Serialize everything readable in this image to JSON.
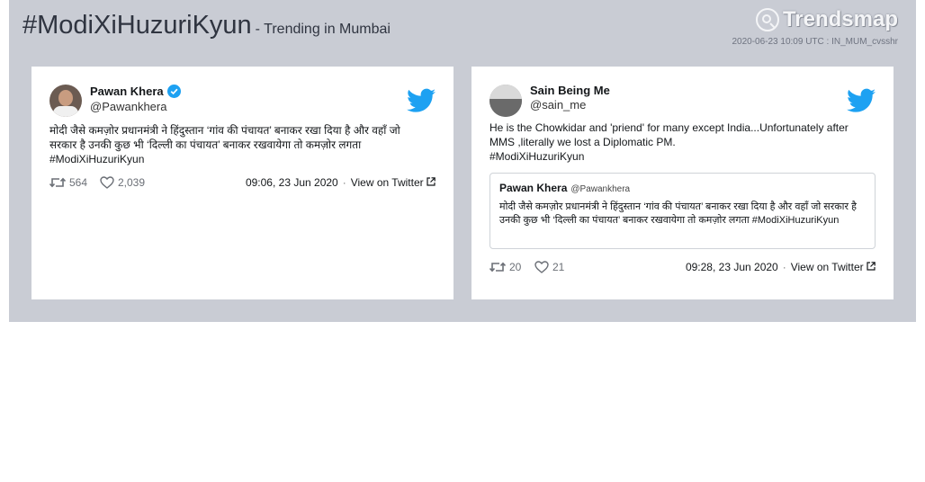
{
  "header": {
    "hashtag": "#ModiXiHuzuriKyun",
    "subtitle": "- Trending in Mumbai",
    "logo_text": "Trendsmap",
    "timestamp": "2020-06-23 10:09 UTC : IN_MUM_cvsshr"
  },
  "tweets": [
    {
      "name": "Pawan Khera",
      "verified": true,
      "handle": "@Pawankhera",
      "text": "मोदी जैसे कमज़ोर प्रधानमंत्री ने हिंदुस्तान ‘गांव की पंचायत’ बनाकर रखा दिया है और वहाँ जो सरकार है उनकी कुछ भी ‘दिल्ली का पंचायत’ बनाकर रखवायेगा तो कमज़ोर लगता",
      "hashtag": "#ModiXiHuzuriKyun",
      "retweets": "564",
      "likes": "2,039",
      "time": "09:06, 23 Jun 2020",
      "view_link": "View on Twitter"
    },
    {
      "name": "Sain Being Me",
      "verified": false,
      "handle": "@sain_me",
      "text": "He is the Chowkidar and 'priend' for many except India...Unfortunately after MMS ,literally we lost a Diplomatic PM.",
      "hashtag": "#ModiXiHuzuriKyun",
      "quote": {
        "name": "Pawan Khera",
        "handle": "@Pawankhera",
        "text": "मोदी जैसे कमज़ोर प्रधानमंत्री ने हिंदुस्तान ‘गांव की पंचायत’ बनाकर रखा दिया है और वहाँ जो सरकार है उनकी कुछ भी ‘दिल्ली का पंचायत’ बनाकर रखवायेगा तो कमज़ोर लगता",
        "hashtag": "#ModiXiHuzuriKyun"
      },
      "retweets": "20",
      "likes": "21",
      "time": "09:28, 23 Jun 2020",
      "view_link": "View on Twitter"
    }
  ],
  "colors": {
    "panel_bg": "#c9ccd4",
    "twitter_blue": "#1da1f2",
    "text_dark": "#14171a"
  }
}
